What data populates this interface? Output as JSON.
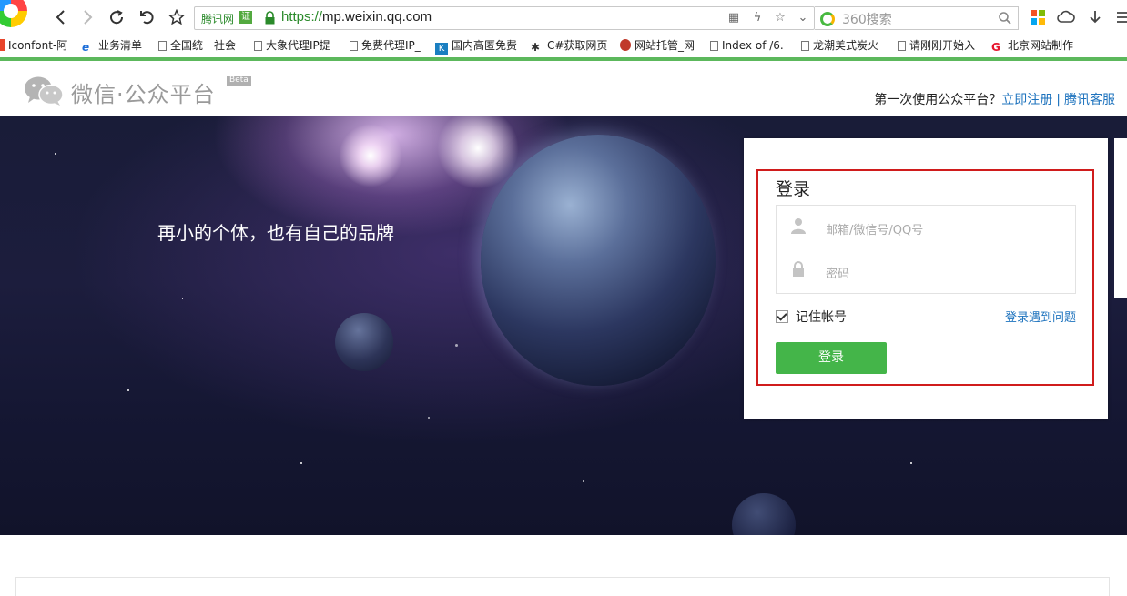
{
  "browser": {
    "site_tag": "腾讯网",
    "cert_label": "证",
    "url_protocol": "https://",
    "url_host": "mp.weixin.qq.com",
    "search_placeholder": "360搜索",
    "bookmarks": [
      {
        "label": "Iconfont-阿",
        "icon": "iconfont-icon"
      },
      {
        "label": "业务清单",
        "icon": "e-icon"
      },
      {
        "label": "全国统一社会",
        "icon": "page-icon"
      },
      {
        "label": "大象代理IP提",
        "icon": "page-icon"
      },
      {
        "label": "免费代理IP_",
        "icon": "page-icon"
      },
      {
        "label": "国内高匿免费",
        "icon": "k-icon"
      },
      {
        "label": "C#获取网页",
        "icon": "spider-icon"
      },
      {
        "label": "网站托管_网",
        "icon": "avatar-icon"
      },
      {
        "label": "Index of /6.",
        "icon": "page-icon"
      },
      {
        "label": "龙潮美式炭火",
        "icon": "page-icon"
      },
      {
        "label": "请刚刚开始入",
        "icon": "page-icon"
      },
      {
        "label": "北京网站制作",
        "icon": "weibo-icon"
      }
    ]
  },
  "header": {
    "brand": "微信·公众平台",
    "beta": "Beta",
    "first_time": "第一次使用公众平台？",
    "register": "立即注册",
    "separator": "|",
    "support": "腾讯客服"
  },
  "banner": {
    "slogan": "再小的个体，也有自己的品牌"
  },
  "login": {
    "title": "登录",
    "account_placeholder": "邮箱/微信号/QQ号",
    "password_placeholder": "密码",
    "remember": "记住帐号",
    "trouble": "登录遇到问题",
    "submit": "登录"
  },
  "colors": {
    "accent_green": "#44b549",
    "link_blue": "#1e73be",
    "highlight_red": "#d01c1c"
  }
}
